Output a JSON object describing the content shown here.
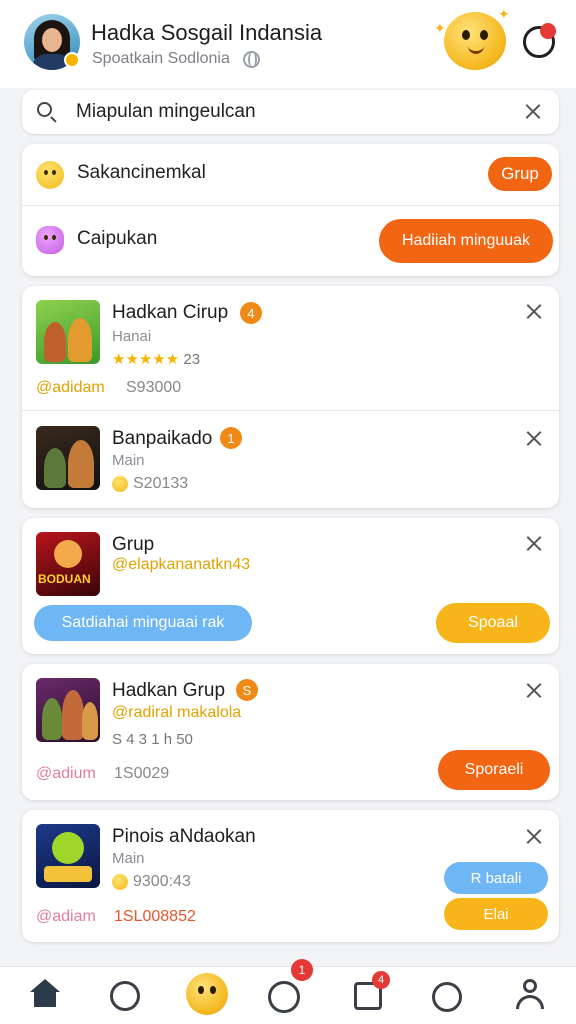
{
  "header": {
    "title": "Hadka Sosgail Indansia",
    "subtitle": "Spoatkain Sodlonia"
  },
  "search": {
    "value": "Miapulan mingeulcan"
  },
  "quick": [
    {
      "label": "Sakancinemkal",
      "button": "Grup"
    },
    {
      "label": "Caipukan",
      "button": "Hadiiah minguuak"
    }
  ],
  "items": [
    {
      "title": "Hadkan Cirup",
      "badge": "4",
      "sub": "Hanai",
      "stars": "★★★★★",
      "rating": "23",
      "link": "@adidam",
      "price": "S93000"
    },
    {
      "title": "Banpaikado",
      "badge": "1",
      "sub": "Main",
      "price": "S20133"
    },
    {
      "title": "Grup",
      "link": "@elapkananatkn43",
      "left_button": "Satdiahai minguaai rak",
      "right_button": "Spoaal",
      "thumb_text": "BODUAN"
    },
    {
      "title": "Hadkan Grup",
      "badge": "S",
      "link": "@radiral makalola",
      "stats": "S 4 3 1 h 50",
      "link2": "@adium",
      "price": "1S0029",
      "button": "Sporaeli"
    },
    {
      "title": "Pinois aNdaokan",
      "sub": "Main",
      "price": "9300:43",
      "link": "@adiam",
      "price2": "1SL008852",
      "button1": "R batali",
      "button2": "Elai"
    }
  ],
  "nav": {
    "badges": [
      "1",
      "4"
    ]
  },
  "colors": {
    "accent_orange": "#f26512",
    "accent_yellow": "#f7b51a",
    "accent_blue": "#6fb6f5",
    "badge_red": "#e53935"
  }
}
